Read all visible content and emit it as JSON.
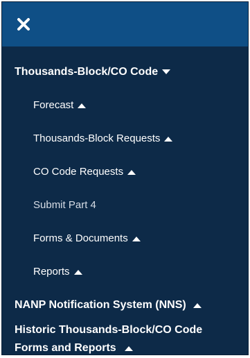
{
  "nav": {
    "close_icon": "close-icon",
    "sections": [
      {
        "label": "Thousands-Block/CO Code",
        "caret": "caret-down-icon",
        "items": [
          {
            "label": "Forecast",
            "caret": "caret-up-icon"
          },
          {
            "label": "Thousands-Block Requests",
            "caret": "caret-up-icon"
          },
          {
            "label": "CO Code Requests",
            "caret": "caret-up-icon"
          },
          {
            "label": "Submit Part 4",
            "caret": ""
          },
          {
            "label": "Forms & Documents",
            "caret": "caret-up-icon"
          },
          {
            "label": "Reports",
            "caret": "caret-up-icon"
          }
        ]
      },
      {
        "label": "NANP Notification System (NNS)",
        "caret": "caret-up-icon"
      },
      {
        "label": "Historic Thousands-Block/CO Code Forms and Reports",
        "caret": "caret-up-icon"
      }
    ]
  },
  "colors": {
    "header": "#0f4f86",
    "panel": "#0d2a48",
    "text": "#ffffff"
  }
}
